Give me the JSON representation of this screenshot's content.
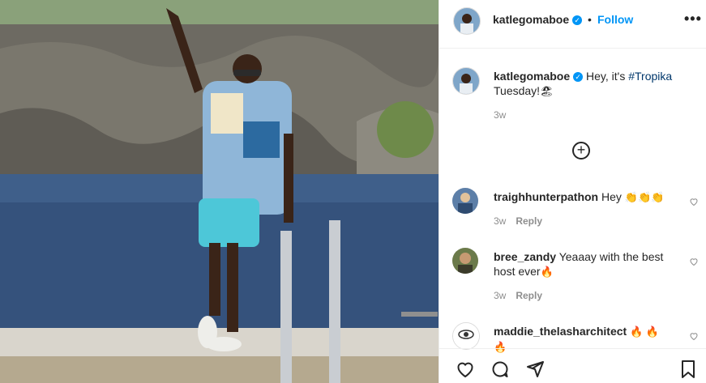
{
  "post": {
    "author": "katlegomaboe",
    "follow_label": "Follow",
    "dot": "•",
    "more_label": "•••",
    "caption": "Hey, it's",
    "hashtag": "#Tropika",
    "caption_tail": "Tuesday!",
    "caption_emoji": "🏖",
    "time": "3w"
  },
  "comments": [
    {
      "user": "traighhunterpathon",
      "text": "Hey",
      "emoji": "👏👏👏",
      "time": "3w",
      "reply": "Reply"
    },
    {
      "user": "bree_zandy",
      "text": "Yeaaay with the best host ever",
      "emoji": "🔥",
      "time": "3w",
      "reply": "Reply"
    },
    {
      "user": "maddie_thelasharchitect",
      "text": "",
      "emoji": "🔥 🔥 🔥",
      "time": "",
      "reply": ""
    }
  ],
  "icons": {
    "verified": "verified-badge-icon",
    "more": "more-options-icon",
    "add": "add-comment-icon",
    "like": "heart-icon",
    "comment": "comment-icon",
    "share": "share-icon",
    "save": "bookmark-icon"
  },
  "colors": {
    "accent": "#0095f6",
    "text": "#262626",
    "muted": "#8e8e8e",
    "hashtag": "#00376b"
  }
}
